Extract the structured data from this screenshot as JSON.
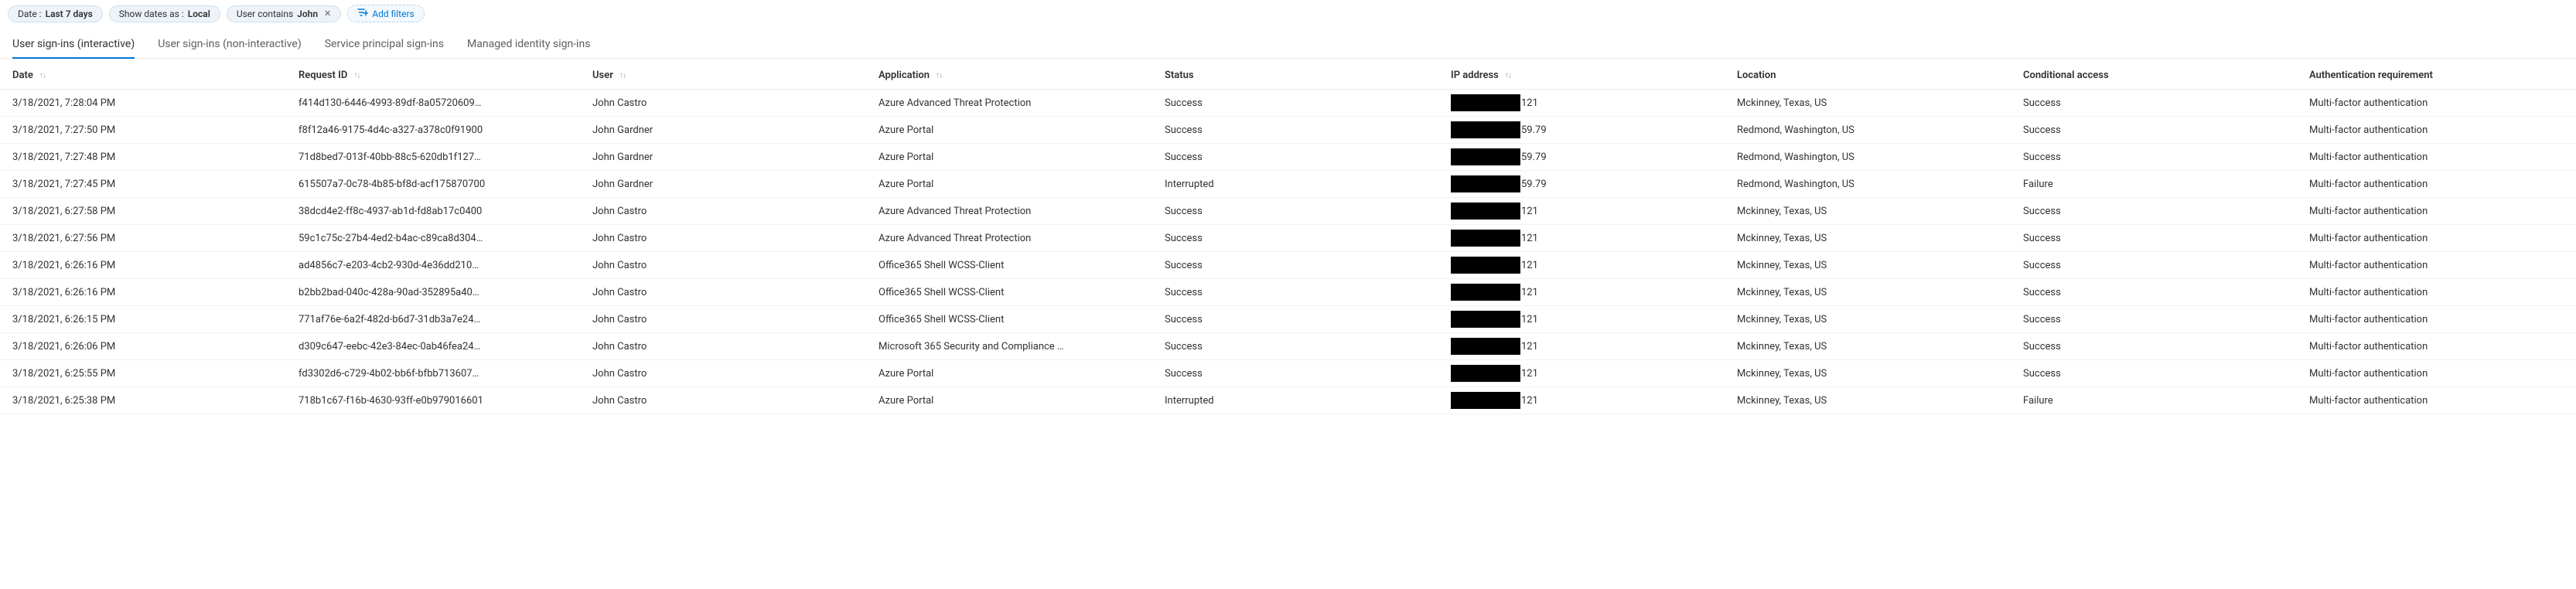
{
  "filters": {
    "date": {
      "prefix": "Date : ",
      "value": "Last 7 days"
    },
    "showDates": {
      "prefix": "Show dates as : ",
      "value": "Local"
    },
    "user": {
      "prefix": "User contains ",
      "value": "John"
    },
    "addLabel": "Add filters"
  },
  "tabs": [
    {
      "label": "User sign-ins (interactive)",
      "active": true
    },
    {
      "label": "User sign-ins (non-interactive)",
      "active": false
    },
    {
      "label": "Service principal sign-ins",
      "active": false
    },
    {
      "label": "Managed identity sign-ins",
      "active": false
    }
  ],
  "columns": {
    "date": "Date",
    "requestId": "Request ID",
    "user": "User",
    "application": "Application",
    "status": "Status",
    "ip": "IP address",
    "location": "Location",
    "conditional": "Conditional access",
    "auth": "Authentication requirement"
  },
  "rows": [
    {
      "date": "3/18/2021, 7:28:04 PM",
      "requestId": "f414d130-6446-4993-89df-8a05720609…",
      "user": "John Castro",
      "application": "Azure Advanced Threat Protection",
      "status": "Success",
      "ipTail": "121",
      "location": "Mckinney, Texas, US",
      "conditional": "Success",
      "auth": "Multi-factor authentication"
    },
    {
      "date": "3/18/2021, 7:27:50 PM",
      "requestId": "f8f12a46-9175-4d4c-a327-a378c0f91900",
      "user": "John Gardner",
      "application": "Azure Portal",
      "status": "Success",
      "ipTail": "59.79",
      "location": "Redmond, Washington, US",
      "conditional": "Success",
      "auth": "Multi-factor authentication"
    },
    {
      "date": "3/18/2021, 7:27:48 PM",
      "requestId": "71d8bed7-013f-40bb-88c5-620db1f127…",
      "user": "John Gardner",
      "application": "Azure Portal",
      "status": "Success",
      "ipTail": "59.79",
      "location": "Redmond, Washington, US",
      "conditional": "Success",
      "auth": "Multi-factor authentication"
    },
    {
      "date": "3/18/2021, 7:27:45 PM",
      "requestId": "615507a7-0c78-4b85-bf8d-acf175870700",
      "user": "John Gardner",
      "application": "Azure Portal",
      "status": "Interrupted",
      "ipTail": "59.79",
      "location": "Redmond, Washington, US",
      "conditional": "Failure",
      "auth": "Multi-factor authentication"
    },
    {
      "date": "3/18/2021, 6:27:58 PM",
      "requestId": "38dcd4e2-ff8c-4937-ab1d-fd8ab17c0400",
      "user": "John Castro",
      "application": "Azure Advanced Threat Protection",
      "status": "Success",
      "ipTail": "121",
      "location": "Mckinney, Texas, US",
      "conditional": "Success",
      "auth": "Multi-factor authentication"
    },
    {
      "date": "3/18/2021, 6:27:56 PM",
      "requestId": "59c1c75c-27b4-4ed2-b4ac-c89ca8d304…",
      "user": "John Castro",
      "application": "Azure Advanced Threat Protection",
      "status": "Success",
      "ipTail": "121",
      "location": "Mckinney, Texas, US",
      "conditional": "Success",
      "auth": "Multi-factor authentication"
    },
    {
      "date": "3/18/2021, 6:26:16 PM",
      "requestId": "ad4856c7-e203-4cb2-930d-4e36dd210…",
      "user": "John Castro",
      "application": "Office365 Shell WCSS-Client",
      "status": "Success",
      "ipTail": "121",
      "location": "Mckinney, Texas, US",
      "conditional": "Success",
      "auth": "Multi-factor authentication"
    },
    {
      "date": "3/18/2021, 6:26:16 PM",
      "requestId": "b2bb2bad-040c-428a-90ad-352895a40…",
      "user": "John Castro",
      "application": "Office365 Shell WCSS-Client",
      "status": "Success",
      "ipTail": "121",
      "location": "Mckinney, Texas, US",
      "conditional": "Success",
      "auth": "Multi-factor authentication"
    },
    {
      "date": "3/18/2021, 6:26:15 PM",
      "requestId": "771af76e-6a2f-482d-b6d7-31db3a7e24…",
      "user": "John Castro",
      "application": "Office365 Shell WCSS-Client",
      "status": "Success",
      "ipTail": "121",
      "location": "Mckinney, Texas, US",
      "conditional": "Success",
      "auth": "Multi-factor authentication"
    },
    {
      "date": "3/18/2021, 6:26:06 PM",
      "requestId": "d309c647-eebc-42e3-84ec-0ab46fea24…",
      "user": "John Castro",
      "application": "Microsoft 365 Security and Compliance …",
      "status": "Success",
      "ipTail": "121",
      "location": "Mckinney, Texas, US",
      "conditional": "Success",
      "auth": "Multi-factor authentication"
    },
    {
      "date": "3/18/2021, 6:25:55 PM",
      "requestId": "fd3302d6-c729-4b02-bb6f-bfbb713607…",
      "user": "John Castro",
      "application": "Azure Portal",
      "status": "Success",
      "ipTail": "121",
      "location": "Mckinney, Texas, US",
      "conditional": "Success",
      "auth": "Multi-factor authentication"
    },
    {
      "date": "3/18/2021, 6:25:38 PM",
      "requestId": "718b1c67-f16b-4630-93ff-e0b979016601",
      "user": "John Castro",
      "application": "Azure Portal",
      "status": "Interrupted",
      "ipTail": "121",
      "location": "Mckinney, Texas, US",
      "conditional": "Failure",
      "auth": "Multi-factor authentication"
    }
  ]
}
